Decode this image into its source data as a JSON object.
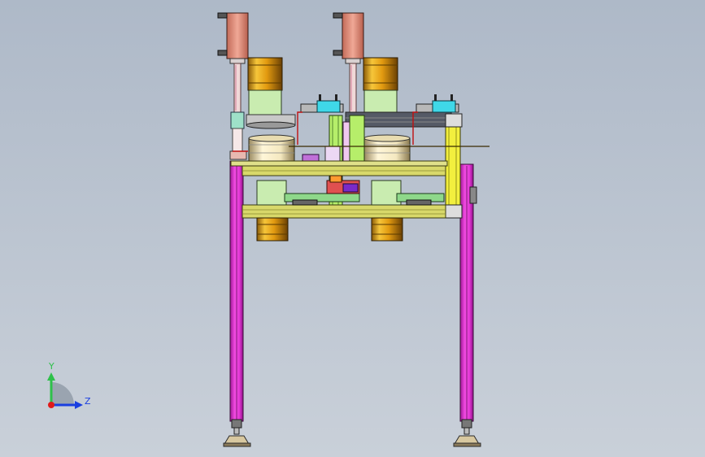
{
  "viewport": {
    "background_top": "#aeb9c8",
    "background_bottom": "#c9d0d9"
  },
  "triad": {
    "y_label": "Y",
    "z_label": "Z",
    "y_color": "#2ec04a",
    "z_color": "#1a3fe0",
    "x_color": "#e01a1a"
  },
  "colors": {
    "frame_legs": "#e63ad8",
    "crossbar": "#d8d86a",
    "motor_yellow": "#f2b21c",
    "motor_green": "#c9ecb0",
    "actuator": "#e89a86",
    "post_yellow": "#f2ef3e",
    "light_green": "#b6ee6a",
    "cyan": "#3fd8e8"
  }
}
